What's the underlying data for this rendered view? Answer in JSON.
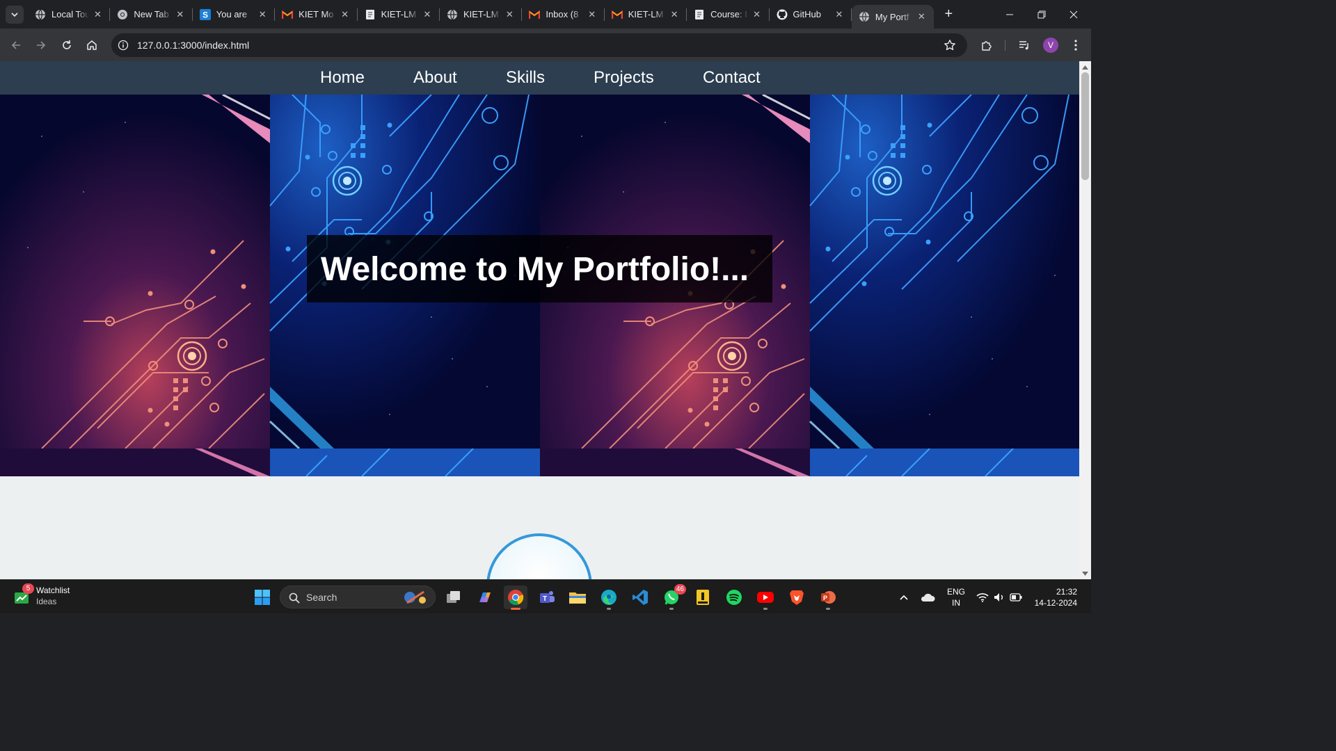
{
  "browser": {
    "tabs": [
      {
        "title": "Local Tour",
        "icon": "globe-icon"
      },
      {
        "title": "New Tab",
        "icon": "chrome-icon"
      },
      {
        "title": "You are",
        "icon": "s-icon"
      },
      {
        "title": "KIET Mo",
        "icon": "gmail-icon"
      },
      {
        "title": "KIET-LM",
        "icon": "doc-icon"
      },
      {
        "title": "KIET-LM",
        "icon": "globe-icon"
      },
      {
        "title": "Inbox (8",
        "icon": "gmail-icon"
      },
      {
        "title": "KIET-LM",
        "icon": "gmail-icon"
      },
      {
        "title": "Course: I",
        "icon": "doc-icon"
      },
      {
        "title": "GitHub",
        "icon": "github-icon"
      },
      {
        "title": "My Portf",
        "icon": "globe-icon",
        "active": true
      }
    ],
    "new_tab_label": "+",
    "url": "127.0.0.1:3000/index.html",
    "profile_initial": "V"
  },
  "page": {
    "nav": [
      "Home",
      "About",
      "Skills",
      "Projects",
      "Contact"
    ],
    "hero_title": "Welcome to My Portfolio!..."
  },
  "taskbar": {
    "widget": {
      "badge": "5",
      "title": "Watchlist",
      "subtitle": "Ideas"
    },
    "search_placeholder": "Search",
    "apps": [
      {
        "name": "start-icon"
      },
      {
        "name": "task-view-icon"
      },
      {
        "name": "copilot-icon"
      },
      {
        "name": "chrome-icon",
        "active": true
      },
      {
        "name": "teams-icon"
      },
      {
        "name": "file-explorer-icon"
      },
      {
        "name": "edge-icon"
      },
      {
        "name": "vscode-icon"
      },
      {
        "name": "whatsapp-icon",
        "badge": "46"
      },
      {
        "name": "notes-icon"
      },
      {
        "name": "spotify-icon"
      },
      {
        "name": "youtube-icon"
      },
      {
        "name": "brave-icon"
      },
      {
        "name": "powerpoint-icon"
      }
    ],
    "lang_top": "ENG",
    "lang_bottom": "IN",
    "time": "21:32",
    "date": "14-12-2024"
  },
  "colors": {
    "nav_bg": "#2c3e50",
    "page_bg": "#ecf0f1",
    "ring": "#3498db",
    "browser_bg": "#202124",
    "toolbar_bg": "#35363a"
  }
}
